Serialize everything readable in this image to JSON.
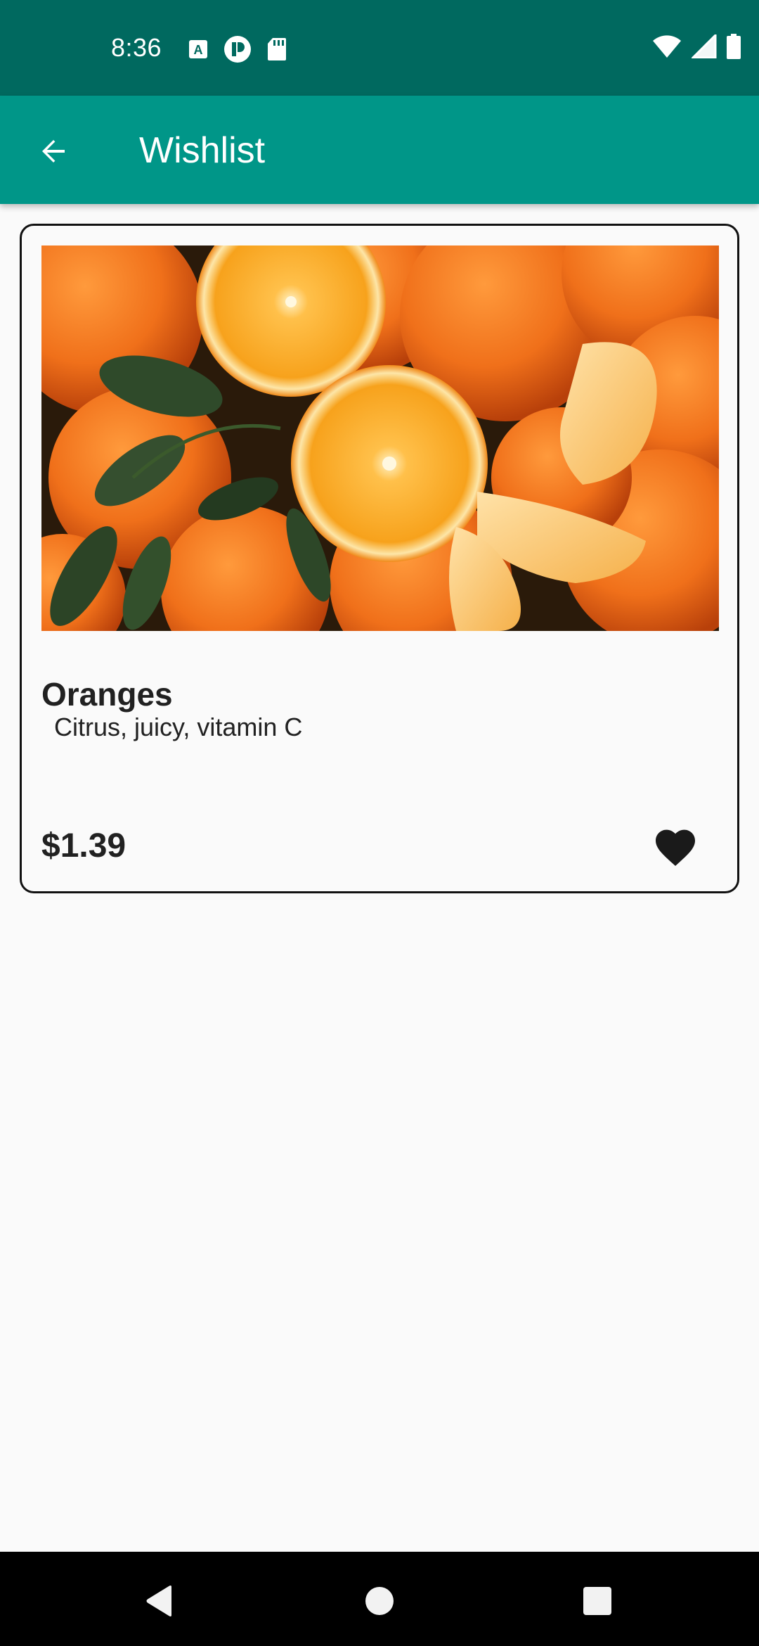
{
  "status_bar": {
    "time": "8:36",
    "left_icons": [
      "a-text-icon",
      "circle-app-icon",
      "sd-card-icon"
    ],
    "right_icons": [
      "wifi-icon",
      "signal-icon",
      "battery-icon"
    ]
  },
  "app_bar": {
    "title": "Wishlist",
    "back_icon": "arrow-back-icon"
  },
  "wishlist": {
    "items": [
      {
        "name": "Oranges",
        "description": " Citrus, juicy, vitamin C",
        "price": "$1.39",
        "favorite": true,
        "image": "oranges-photo"
      }
    ]
  },
  "nav_bar": {
    "buttons": [
      "back-triangle-icon",
      "home-circle-icon",
      "recents-square-icon"
    ]
  },
  "colors": {
    "status_bar": "#00695f",
    "app_bar": "#009688",
    "background": "#fafafa",
    "text": "#212121",
    "nav_bar": "#000000"
  }
}
